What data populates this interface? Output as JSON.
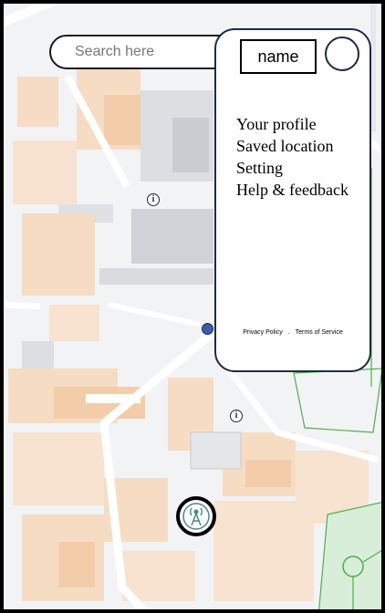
{
  "search": {
    "placeholder": "Search here"
  },
  "profile_panel": {
    "name_label": "name",
    "menu": [
      "Your profile",
      "Saved location",
      "Setting",
      "Help & feedback"
    ],
    "footer": {
      "privacy": "Privacy Policy",
      "separator": ".",
      "terms": "Terms of Service"
    }
  },
  "map": {
    "info_marker_glyph": "i",
    "icons": [
      "info-icon",
      "current-location-dot",
      "signal-tower-icon",
      "avatar-icon"
    ],
    "colors": {
      "building_orange": "#f7d9bf",
      "building_gray": "#d6d8dc",
      "road": "#ffffff",
      "park_line": "#4caf50",
      "park_fill": "#d8eed8",
      "location_dot": "#3b5bab"
    }
  }
}
